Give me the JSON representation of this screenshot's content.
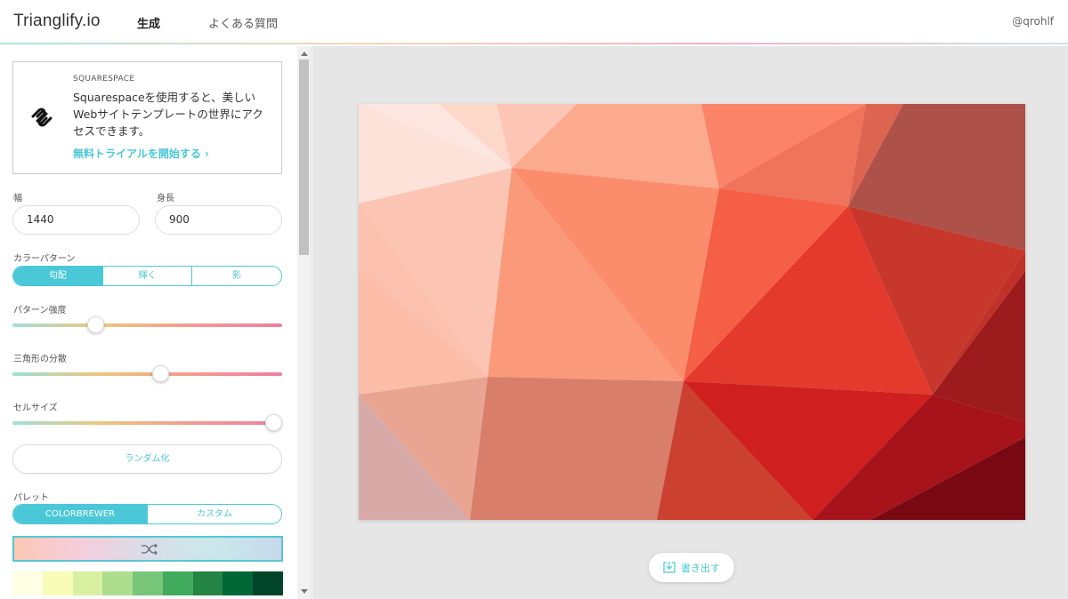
{
  "app": {
    "brand": "Trianglify.io",
    "user": "@qrohlf"
  },
  "nav": {
    "generate": "生成",
    "faq": "よくある質問"
  },
  "ad": {
    "sponsor": "SQUARESPACE",
    "text": "Squarespaceを使用すると、美しいWebサイトテンプレートの世界にアクセスできます。",
    "cta": "無料トライアルを開始する ›"
  },
  "dimensions": {
    "width_label": "幅",
    "width_value": "1440",
    "height_label": "身長",
    "height_value": "900"
  },
  "color_pattern": {
    "label": "カラーパターン",
    "options": [
      "勾配",
      "輝く",
      "影"
    ],
    "selected": "勾配"
  },
  "sliders": {
    "intensity": {
      "label": "パターン強度",
      "value": 0.31
    },
    "variance": {
      "label": "三角形の分散",
      "value": 0.55
    },
    "cell_size": {
      "label": "セルサイズ",
      "value": 0.97
    }
  },
  "randomize": {
    "label": "ランダム化"
  },
  "palette": {
    "label": "パレット",
    "options": [
      "COLORBREWER",
      "カスタム"
    ],
    "selected": "COLORBREWER",
    "preview_colors": [
      "#fcc9b6",
      "#f5cddc",
      "#d9dde8",
      "#c9e8ea",
      "#c7d9ec"
    ],
    "swatches": [
      "#ffffe5",
      "#f7fcb9",
      "#d9f0a3",
      "#addd8e",
      "#78c679",
      "#41ab5d",
      "#238443",
      "#006837",
      "#004529"
    ]
  },
  "export": {
    "label": "書き出す"
  },
  "colors": {
    "accent": "#4ac8d7"
  },
  "icons": {
    "logo": "squarespace-logo-icon",
    "shuffle": "shuffle-icon",
    "export": "download-icon"
  }
}
